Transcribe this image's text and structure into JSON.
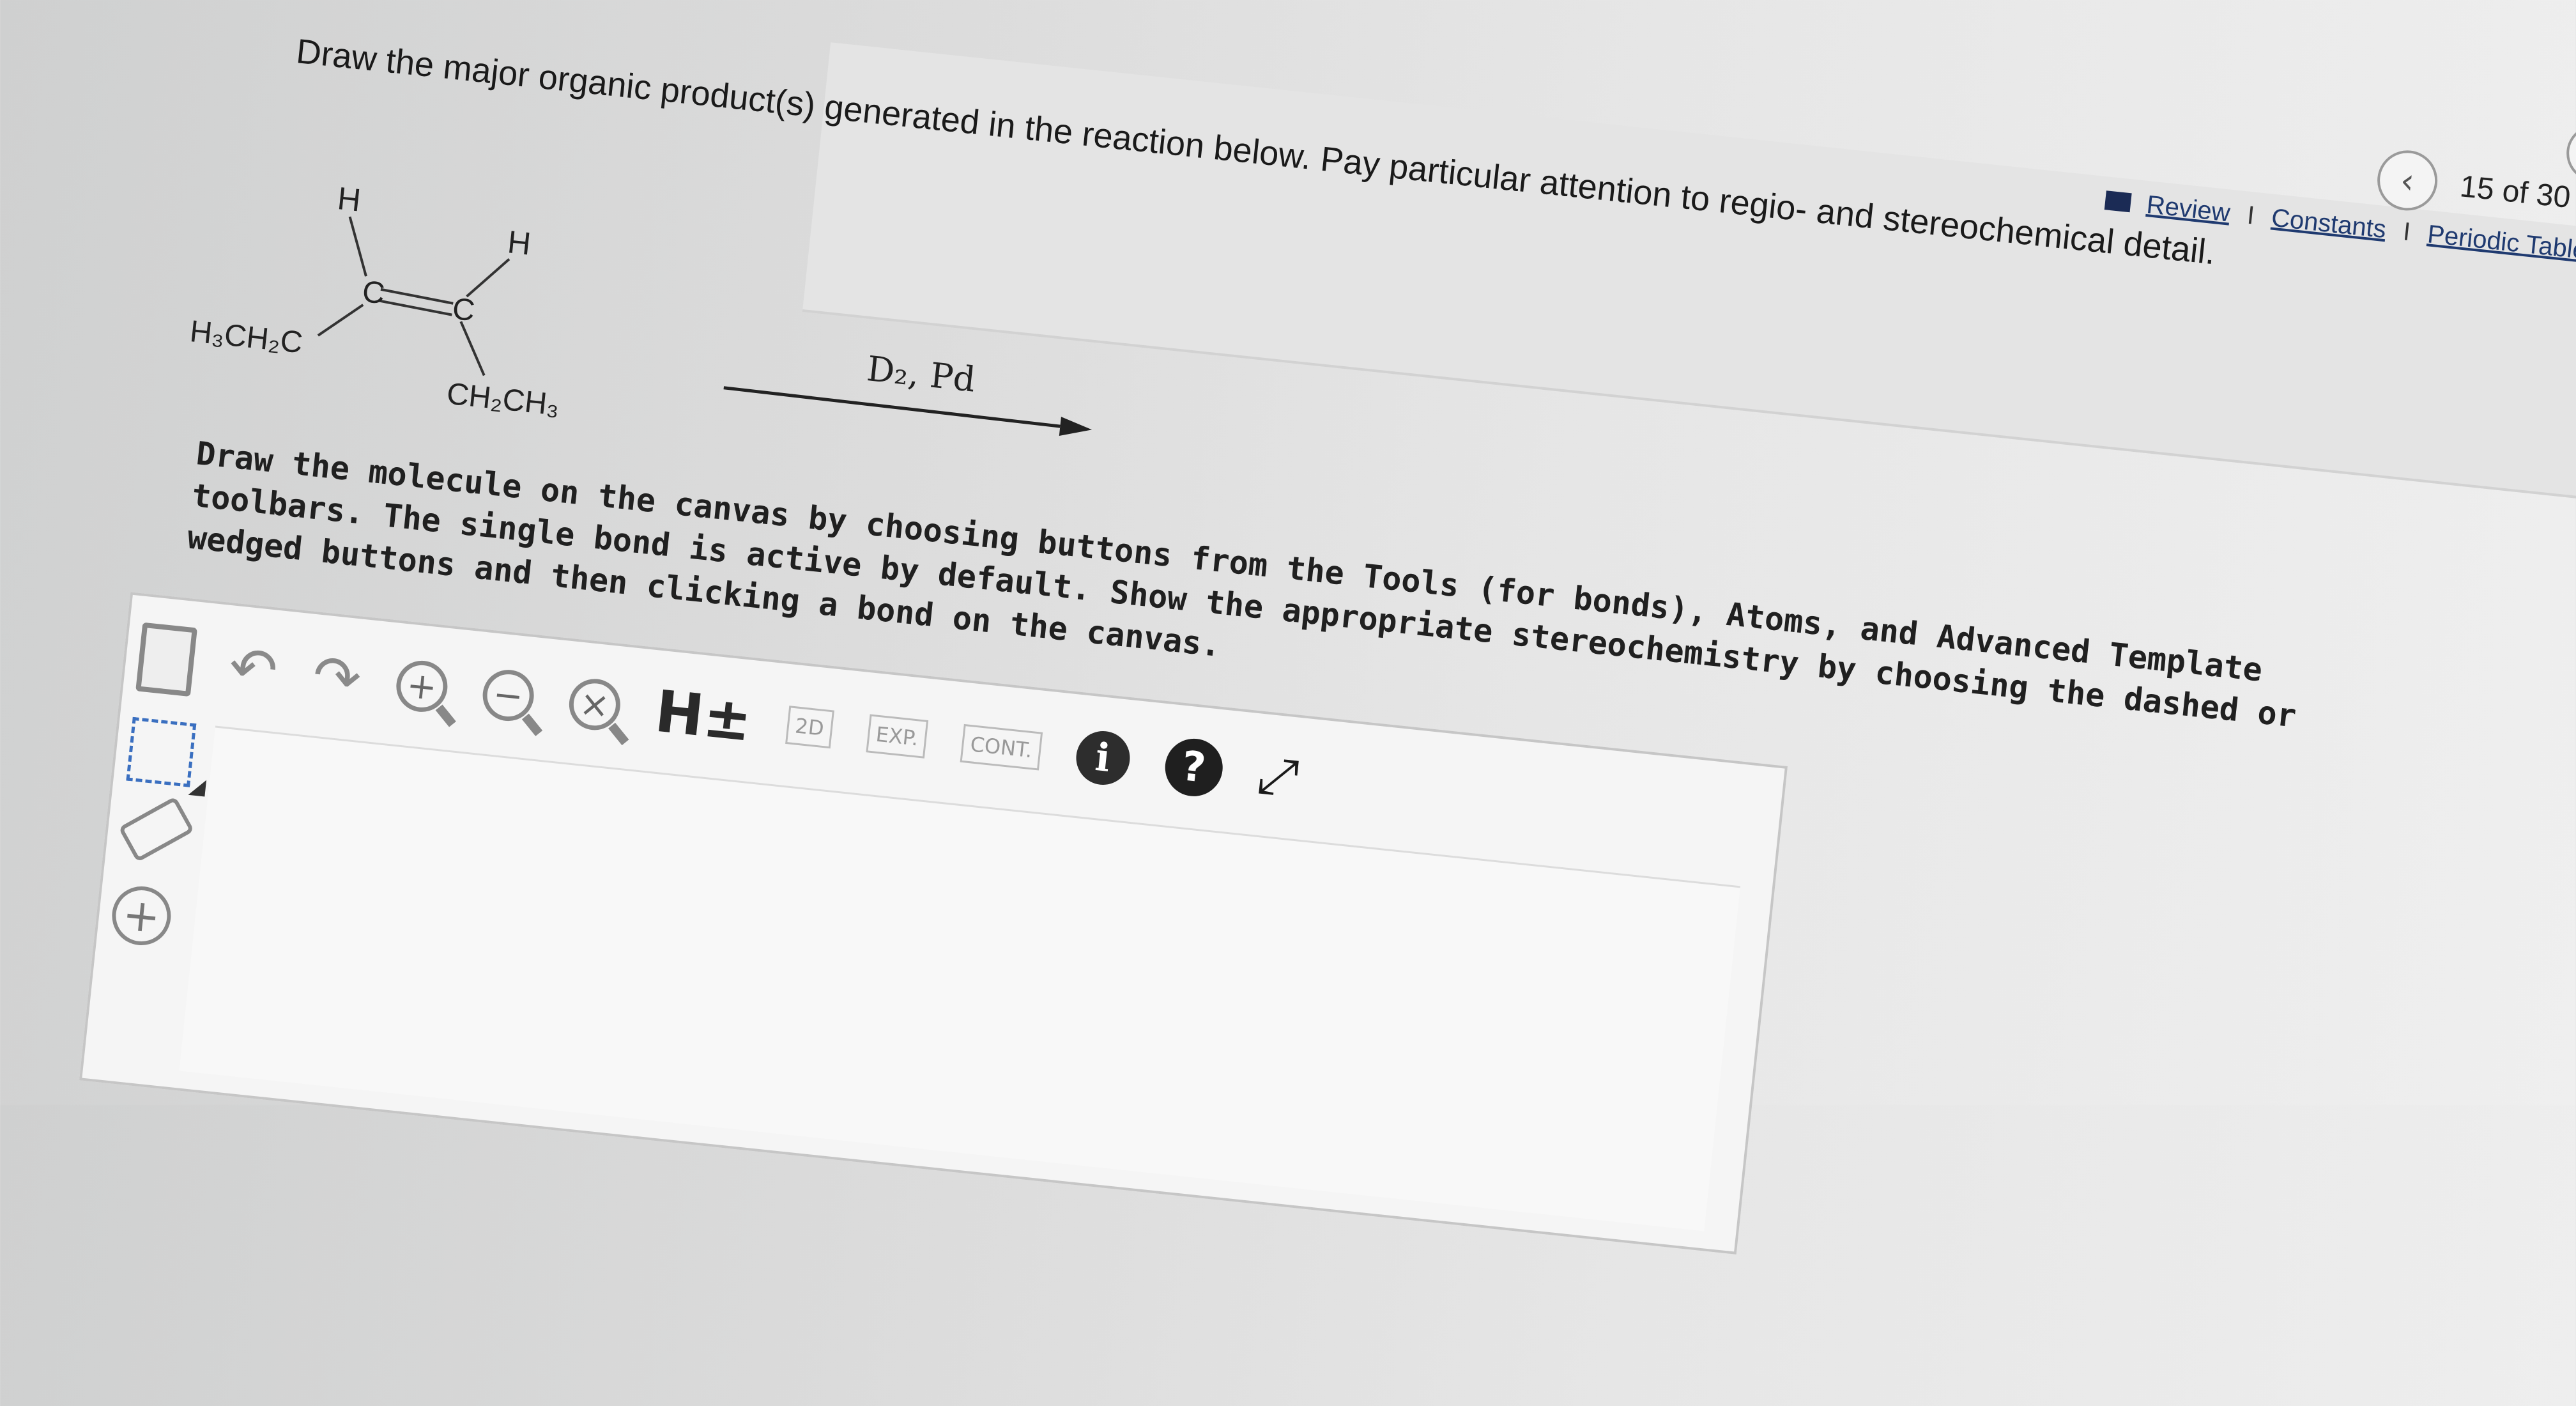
{
  "header": {
    "pager": "15 of 30",
    "prev_icon": "chevron-left-icon",
    "links": [
      "Review",
      "Constants",
      "Periodic Table"
    ],
    "separator": "I"
  },
  "question": {
    "prompt": "Draw the major organic product(s) generated in the reaction below. Pay particular attention to regio- and stereochemical detail."
  },
  "reaction": {
    "reagent": "D₂, Pd",
    "atoms": {
      "h_left": "H",
      "h_right": "H",
      "c_left": "C",
      "c_right": "C",
      "sub_left": "H₃CH₂C",
      "sub_right": "CH₂CH₃"
    }
  },
  "instructions": {
    "text": "Draw the molecule on the canvas by choosing buttons from the Tools (for bonds), Atoms, and Advanced Template toolbars. The single bond is active by default. Show the appropriate stereochemistry by choosing the dashed or wedged buttons and then clicking a bond on the canvas."
  },
  "toolbar": {
    "undo": "↶",
    "redo": "↷",
    "zoom_in": "+",
    "zoom_out": "−",
    "clear": "×",
    "hydrogens": "H±",
    "clean2d": "2D",
    "expand": "EXP.",
    "contract": "CONT.",
    "info": "i",
    "help": "?",
    "fullscreen": "⤢"
  },
  "side_tools": {
    "add": "+"
  }
}
